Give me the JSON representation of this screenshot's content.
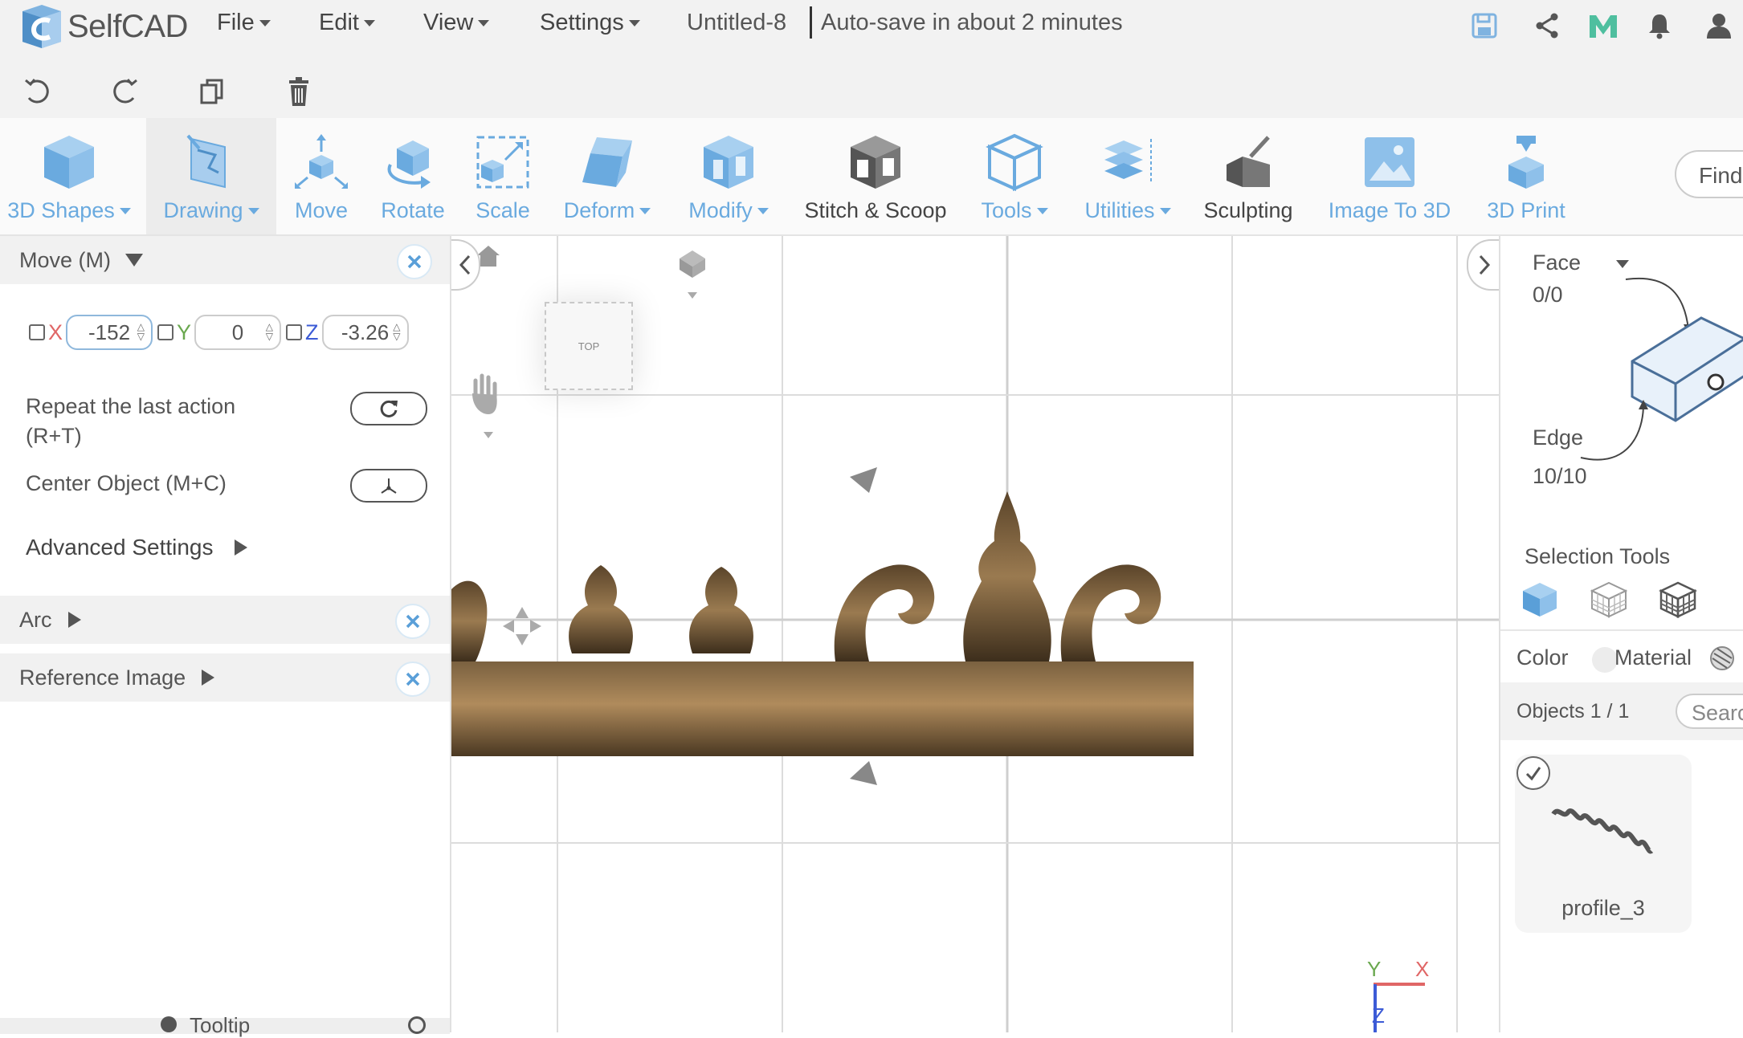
{
  "app": {
    "name": "SelfCAD"
  },
  "menus": [
    {
      "id": "file",
      "label": "File"
    },
    {
      "id": "edit",
      "label": "Edit"
    },
    {
      "id": "view",
      "label": "View"
    },
    {
      "id": "settings",
      "label": "Settings"
    }
  ],
  "document": {
    "title": "Untitled-8",
    "autosave": "Auto-save in about 2 minutes"
  },
  "ribbon": {
    "shapes": "3D Shapes",
    "drawing": "Drawing",
    "move": "Move",
    "rotate": "Rotate",
    "scale": "Scale",
    "deform": "Deform",
    "modify": "Modify",
    "stitch": "Stitch & Scoop",
    "tools": "Tools",
    "utilities": "Utilities",
    "sculpting": "Sculpting",
    "image3d": "Image To 3D",
    "print3d": "3D Print",
    "find": "Find"
  },
  "move_panel": {
    "title": "Move (M)",
    "x_label": "X",
    "x_value": "-152",
    "y_label": "Y",
    "y_value": "0",
    "z_label": "Z",
    "z_value": "-3.26",
    "repeat_line1": "Repeat the last action",
    "repeat_line2": "(R+T)",
    "center": "Center Object (M+C)",
    "advanced": "Advanced Settings"
  },
  "arc_panel": {
    "title": "Arc"
  },
  "ref_panel": {
    "title": "Reference Image"
  },
  "tooltip": {
    "label": "Tooltip"
  },
  "viewport": {
    "view_label": "TOP",
    "axis_y": "Y",
    "axis_x": "X",
    "axis_z": "Z",
    "colors": {
      "x": "#e06666",
      "y": "#6aa84f",
      "z": "#3c5bd6"
    }
  },
  "right_panel": {
    "face_label": "Face",
    "face_value": "0/0",
    "edge_label": "Edge",
    "edge_value": "10/10",
    "selection_tools": "Selection Tools",
    "color_label": "Color",
    "material_label": "Material",
    "objects_label": "Objects 1 / 1",
    "search_placeholder": "Search",
    "object_name": "profile_3"
  },
  "theme": {
    "accent": "#6aaadf",
    "bar_bg": "#f2f2f2"
  }
}
